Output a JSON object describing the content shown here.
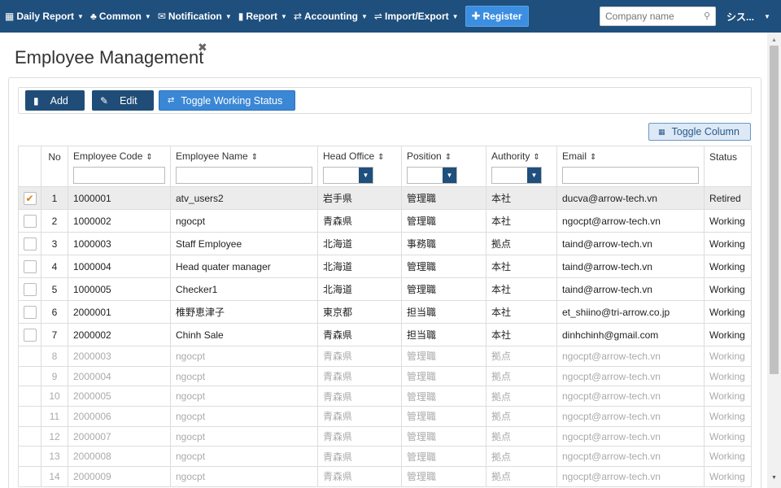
{
  "nav": {
    "items": [
      {
        "icon": "calendar-icon",
        "glyph": "▦",
        "label": "Daily Report"
      },
      {
        "icon": "users-icon",
        "glyph": "♣",
        "label": "Common"
      },
      {
        "icon": "envelope-icon",
        "glyph": "✉",
        "label": "Notification"
      },
      {
        "icon": "bar-chart-icon",
        "glyph": "▮",
        "label": "Report"
      },
      {
        "icon": "refresh-icon",
        "glyph": "⇄",
        "label": "Accounting"
      },
      {
        "icon": "exchange-icon",
        "glyph": "⇌",
        "label": "Import/Export"
      }
    ],
    "register_label": "Register",
    "company_placeholder": "Company name",
    "user_label": "シス..."
  },
  "page": {
    "title": "Employee Management"
  },
  "toolbar": {
    "add_label": "Add",
    "edit_label": "Edit",
    "toggle_status_label": "Toggle Working Status",
    "toggle_column_label": "Toggle Column"
  },
  "table": {
    "headers": {
      "no": "No",
      "code": "Employee Code",
      "name": "Employee Name",
      "office": "Head Office",
      "position": "Position",
      "authority": "Authority",
      "email": "Email",
      "status": "Status"
    },
    "rows": [
      {
        "no": "1",
        "code": "1000001",
        "name": "atv_users2",
        "office": "岩手県",
        "position": "管理職",
        "authority": "本社",
        "email": "ducva@arrow-tech.vn",
        "status": "Retired",
        "checked": true,
        "dim": false
      },
      {
        "no": "2",
        "code": "1000002",
        "name": "ngocpt",
        "office": "青森県",
        "position": "管理職",
        "authority": "本社",
        "email": "ngocpt@arrow-tech.vn",
        "status": "Working",
        "checked": false,
        "dim": false
      },
      {
        "no": "3",
        "code": "1000003",
        "name": "Staff Employee",
        "office": "北海道",
        "position": "事務職",
        "authority": "拠点",
        "email": "taind@arrow-tech.vn",
        "status": "Working",
        "checked": false,
        "dim": false
      },
      {
        "no": "4",
        "code": "1000004",
        "name": "Head quater manager",
        "office": "北海道",
        "position": "管理職",
        "authority": "本社",
        "email": "taind@arrow-tech.vn",
        "status": "Working",
        "checked": false,
        "dim": false
      },
      {
        "no": "5",
        "code": "1000005",
        "name": "Checker1",
        "office": "北海道",
        "position": "管理職",
        "authority": "本社",
        "email": "taind@arrow-tech.vn",
        "status": "Working",
        "checked": false,
        "dim": false
      },
      {
        "no": "6",
        "code": "2000001",
        "name": "椎野恵津子",
        "office": "東京都",
        "position": "担当職",
        "authority": "本社",
        "email": "et_shiino@tri-arrow.co.jp",
        "status": "Working",
        "checked": false,
        "dim": false
      },
      {
        "no": "7",
        "code": "2000002",
        "name": "Chinh Sale",
        "office": "青森県",
        "position": "担当職",
        "authority": "本社",
        "email": "dinhchinh@gmail.com",
        "status": "Working",
        "checked": false,
        "dim": false
      },
      {
        "no": "8",
        "code": "2000003",
        "name": "ngocpt",
        "office": "青森県",
        "position": "管理職",
        "authority": "拠点",
        "email": "ngocpt@arrow-tech.vn",
        "status": "Working",
        "checked": false,
        "dim": true
      },
      {
        "no": "9",
        "code": "2000004",
        "name": "ngocpt",
        "office": "青森県",
        "position": "管理職",
        "authority": "拠点",
        "email": "ngocpt@arrow-tech.vn",
        "status": "Working",
        "checked": false,
        "dim": true
      },
      {
        "no": "10",
        "code": "2000005",
        "name": "ngocpt",
        "office": "青森県",
        "position": "管理職",
        "authority": "拠点",
        "email": "ngocpt@arrow-tech.vn",
        "status": "Working",
        "checked": false,
        "dim": true
      },
      {
        "no": "11",
        "code": "2000006",
        "name": "ngocpt",
        "office": "青森県",
        "position": "管理職",
        "authority": "拠点",
        "email": "ngocpt@arrow-tech.vn",
        "status": "Working",
        "checked": false,
        "dim": true
      },
      {
        "no": "12",
        "code": "2000007",
        "name": "ngocpt",
        "office": "青森県",
        "position": "管理職",
        "authority": "拠点",
        "email": "ngocpt@arrow-tech.vn",
        "status": "Working",
        "checked": false,
        "dim": true
      },
      {
        "no": "13",
        "code": "2000008",
        "name": "ngocpt",
        "office": "青森県",
        "position": "管理職",
        "authority": "拠点",
        "email": "ngocpt@arrow-tech.vn",
        "status": "Working",
        "checked": false,
        "dim": true
      },
      {
        "no": "14",
        "code": "2000009",
        "name": "ngocpt",
        "office": "青森県",
        "position": "管理職",
        "authority": "拠点",
        "email": "ngocpt@arrow-tech.vn",
        "status": "Working",
        "checked": false,
        "dim": true
      }
    ]
  },
  "colors": {
    "navbar": "#1e4f7d",
    "primary_button": "#1f4d78",
    "toggle_button": "#3a87d6",
    "checkmark": "#e07b1a"
  }
}
